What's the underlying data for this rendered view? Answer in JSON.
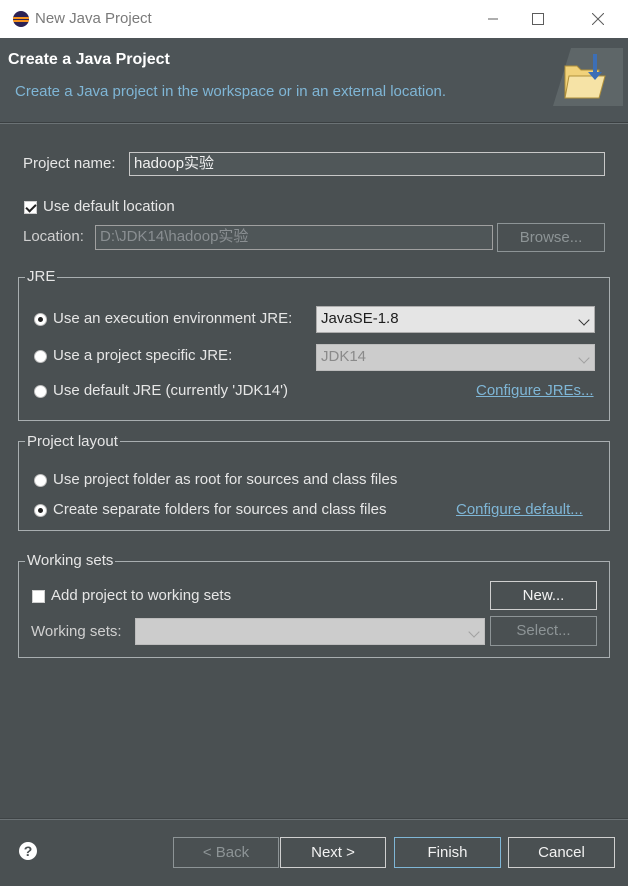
{
  "window": {
    "title": "New Java Project",
    "min_icon": "window-minimize",
    "max_icon": "window-maximize",
    "close_icon": "window-close"
  },
  "header": {
    "title": "Create a Java Project",
    "description": "Create a Java project in the workspace or in an external location.",
    "icon": "java-project-folder-icon"
  },
  "project": {
    "name_label": "Project name:",
    "name_value": "hadoop实验"
  },
  "location": {
    "use_default_label": "Use default location",
    "use_default_checked": true,
    "location_label": "Location:",
    "location_value": "D:\\JDK14\\hadoop实验",
    "browse_label": "Browse..."
  },
  "jre": {
    "group_title": "JRE",
    "exec_env_label": "Use an execution environment JRE:",
    "exec_env_value": "JavaSE-1.8",
    "exec_env_selected": true,
    "project_specific_label": "Use a project specific JRE:",
    "project_specific_value": "JDK14",
    "default_jre_label": "Use default JRE (currently 'JDK14')",
    "configure_link": "Configure JREs..."
  },
  "layout": {
    "group_title": "Project layout",
    "root_label": "Use project folder as root for sources and class files",
    "separate_label": "Create separate folders for sources and class files",
    "separate_selected": true,
    "configure_link": "Configure default..."
  },
  "working_sets": {
    "group_title": "Working sets",
    "add_label": "Add project to working sets",
    "add_checked": false,
    "new_button": "New...",
    "sets_label": "Working sets:",
    "sets_value": "",
    "select_button": "Select..."
  },
  "footer": {
    "help_icon": "help-icon",
    "back_label": "< Back",
    "next_label": "Next >",
    "finish_label": "Finish",
    "cancel_label": "Cancel"
  },
  "colors": {
    "background": "#4a5052",
    "link": "#7fb6d6",
    "header_bg": "#4d5457"
  }
}
